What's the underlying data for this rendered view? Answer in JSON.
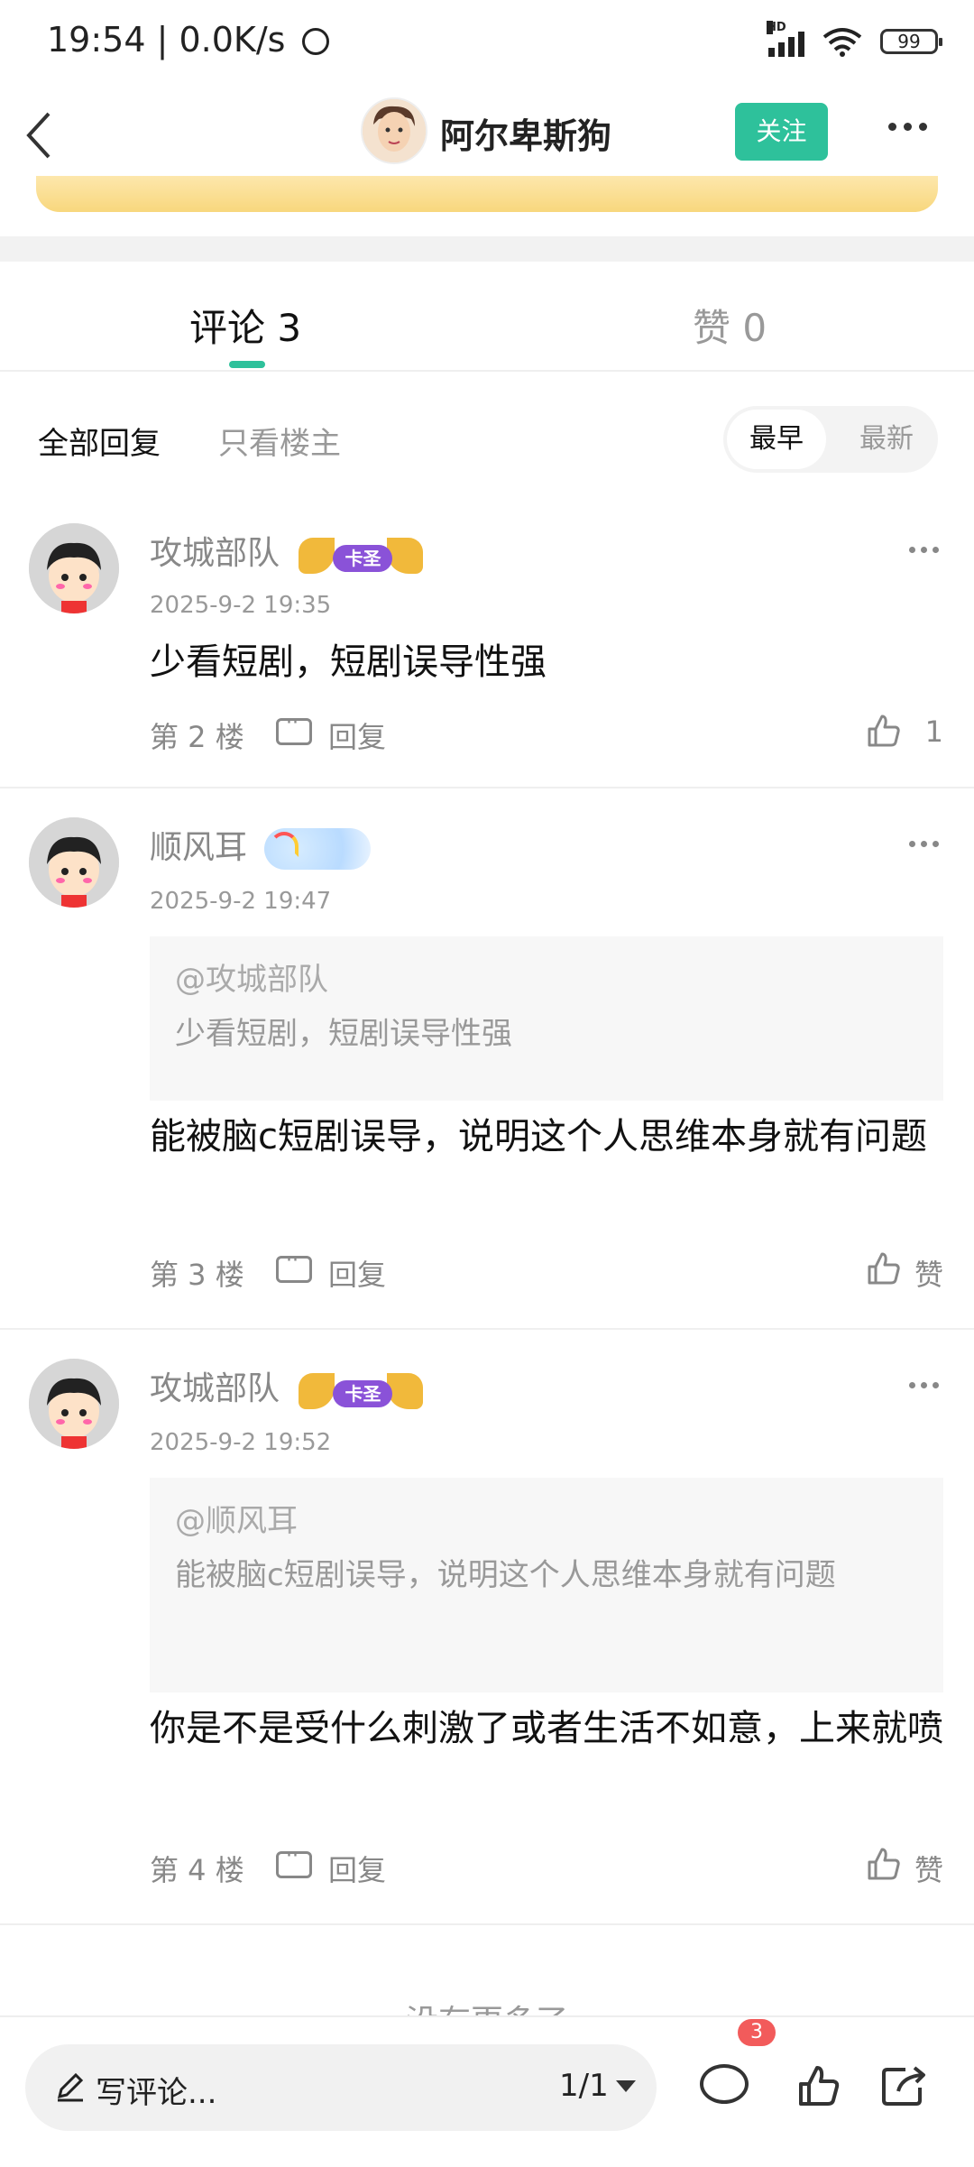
{
  "status_bar": {
    "time": "19:54",
    "net_speed": "0.0K/s",
    "network": "HD",
    "battery": "99"
  },
  "header": {
    "username": "阿尔卑斯狗",
    "follow_label": "关注"
  },
  "tabs": [
    {
      "label": "评论 3"
    },
    {
      "label": "赞 0"
    }
  ],
  "filters": {
    "all": "全部回复",
    "op_only": "只看楼主",
    "sort_early": "最早",
    "sort_new": "最新"
  },
  "comments": [
    {
      "user": "攻城部队",
      "badge": "卡圣",
      "date": "2025-9-2 19:35",
      "text": "少看短剧，短剧误导性强",
      "floor": "第 2 楼",
      "reply": "回复",
      "like": "1"
    },
    {
      "user": "顺风耳",
      "date": "2025-9-2 19:47",
      "quote_user": "@攻城部队",
      "quote_text": "少看短剧，短剧误导性强",
      "text": "能被脑c短剧误导，说明这个人思维本身就有问题",
      "floor": "第 3 楼",
      "reply": "回复",
      "like": "赞"
    },
    {
      "user": "攻城部队",
      "badge": "卡圣",
      "date": "2025-9-2 19:52",
      "quote_user": "@顺风耳",
      "quote_text": "能被脑c短剧误导，说明这个人思维本身就有问题",
      "text": "你是不是受什么刺激了或者生活不如意，上来就喷",
      "floor": "第 4 楼",
      "reply": "回复",
      "like": "赞"
    }
  ],
  "footer": {
    "no_more": "没有更多了"
  },
  "bottom_bar": {
    "placeholder": "写评论...",
    "page": "1/1",
    "comment_count": "3"
  },
  "colors": {
    "accent": "#2ec19b",
    "badge_red": "#f25b5b"
  }
}
